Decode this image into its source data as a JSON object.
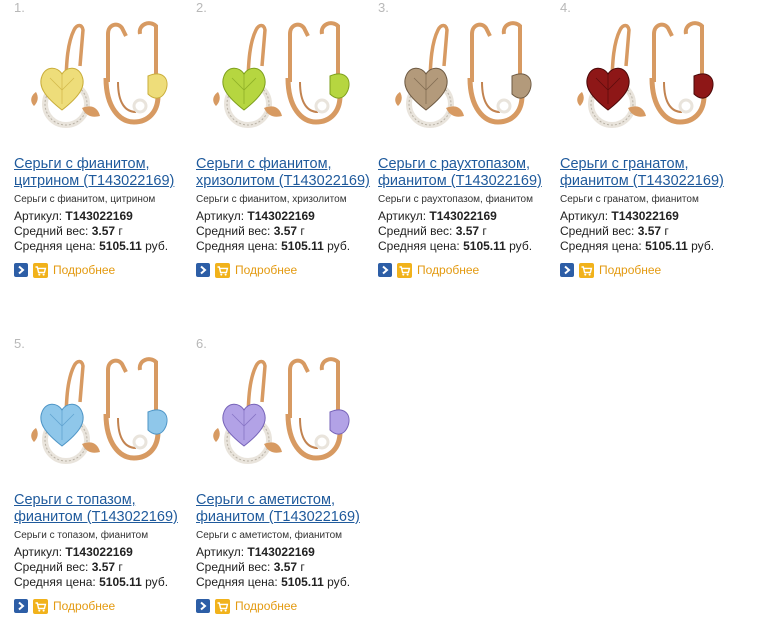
{
  "labels": {
    "article_prefix": "Артикул: ",
    "weight_prefix": "Средний вес: ",
    "price_prefix": "Средняя цена: ",
    "more": "Подробнее"
  },
  "products": [
    {
      "number": "1.",
      "title": "Серьги с фианитом, цитрином (T143022169)",
      "desc": "Серьги с фианитом, цитрином",
      "article": "T143022169",
      "weight": "3.57",
      "weight_unit": " г",
      "price": "5105.11",
      "price_unit": " руб.",
      "stone_color": "#eedd7a",
      "stone_dark": "#c9ad3a",
      "image_icon": "earrings-image"
    },
    {
      "number": "2.",
      "title": "Серьги с фианитом, хризолитом (T143022169)",
      "desc": "Серьги с фианитом, хризолитом",
      "article": "T143022169",
      "weight": "3.57",
      "weight_unit": " г",
      "price": "5105.11",
      "price_unit": " руб.",
      "stone_color": "#b6d640",
      "stone_dark": "#7e9f1d",
      "image_icon": "earrings-image"
    },
    {
      "number": "3.",
      "title": "Серьги с раухтопазом, фианитом (T143022169)",
      "desc": "Серьги с раухтопазом, фианитом",
      "article": "T143022169",
      "weight": "3.57",
      "weight_unit": " г",
      "price": "5105.11",
      "price_unit": " руб.",
      "stone_color": "#b39a7b",
      "stone_dark": "#6e5a43",
      "image_icon": "earrings-image"
    },
    {
      "number": "4.",
      "title": "Серьги с гранатом, фианитом (T143022169)",
      "desc": "Серьги с гранатом, фианитом",
      "article": "T143022169",
      "weight": "3.57",
      "weight_unit": " г",
      "price": "5105.11",
      "price_unit": " руб.",
      "stone_color": "#8e1717",
      "stone_dark": "#4a0808",
      "image_icon": "earrings-image"
    },
    {
      "number": "5.",
      "title": "Серьги с топазом, фианитом (T143022169)",
      "desc": "Серьги с топазом, фианитом",
      "article": "T143022169",
      "weight": "3.57",
      "weight_unit": " г",
      "price": "5105.11",
      "price_unit": " руб.",
      "stone_color": "#8fc7ea",
      "stone_dark": "#4e95c6",
      "image_icon": "earrings-image"
    },
    {
      "number": "6.",
      "title": "Серьги с аметистом, фианитом (T143022169)",
      "desc": "Серьги с аметистом, фианитом",
      "article": "T143022169",
      "weight": "3.57",
      "weight_unit": " г",
      "price": "5105.11",
      "price_unit": " руб.",
      "stone_color": "#b2a2e6",
      "stone_dark": "#7663b8",
      "image_icon": "earrings-image"
    }
  ],
  "icons": {
    "go_icon": "arrow-right-icon",
    "cart_icon": "shopping-cart-icon"
  },
  "colors": {
    "link": "#1f5a9c",
    "more": "#e39a11",
    "go_button": "#2d5ea6",
    "cart_button": "#f1b21b",
    "gold": "#d79a62"
  }
}
